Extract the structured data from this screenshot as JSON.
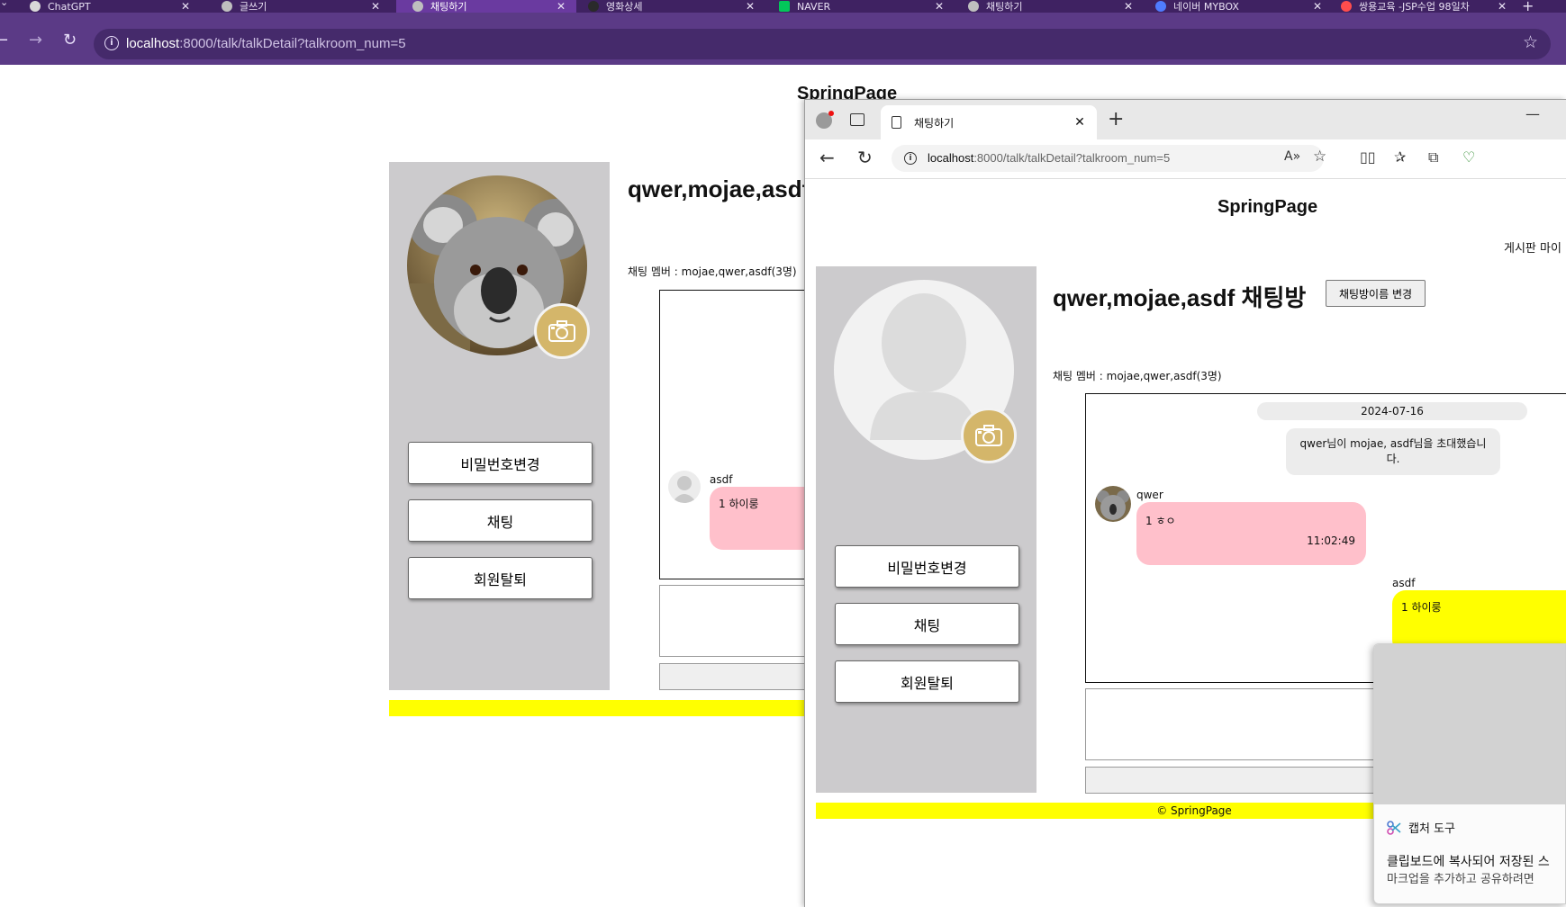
{
  "browser_back": {
    "tabs": [
      {
        "title": "ChatGPT",
        "active": false,
        "favicon_color": "#d9d9d9"
      },
      {
        "title": "글쓰기",
        "active": false,
        "favicon_color": "#bfbfbf"
      },
      {
        "title": "채팅하기",
        "active": true,
        "favicon_color": "#bfbfbf"
      },
      {
        "title": "영화상세",
        "active": false,
        "favicon_color": "#2a2a2a"
      },
      {
        "title": "NAVER",
        "active": false,
        "favicon_color": "#03c75a"
      },
      {
        "title": "채팅하기",
        "active": false,
        "favicon_color": "#bfbfbf"
      },
      {
        "title": "네이버 MYBOX",
        "active": false,
        "favicon_color": "#4f7cff"
      },
      {
        "title": "쌍용교육 -JSP수업 98일차",
        "active": false,
        "favicon_color": "#ff4d4d"
      }
    ],
    "close_glyph": "✕",
    "new_tab_glyph": "+",
    "url_host": "localhost",
    "url_rest": ":8000/talk/talkDetail?talkroom_num=5",
    "icons": {
      "back": "back-arrow-icon",
      "forward": "forward-arrow-icon",
      "reload": "reload-icon",
      "bookmark": "star-icon"
    }
  },
  "page_back": {
    "site_title": "SpringPage",
    "room_title": "qwer,mojae,asdf",
    "members": "채팅 멤버 : mojae,qwer,asdf(3명)",
    "sidebar_buttons": [
      "비밀번호변경",
      "채팅",
      "회원탈퇴"
    ],
    "message": {
      "sender": "asdf",
      "text": "1 하이룽",
      "bubble_color": "#ffc0cb"
    },
    "footer_color": "#ffff00"
  },
  "browser_front": {
    "tab_title": "채팅하기",
    "url_host": "localhost",
    "url_rest": ":8000/talk/talkDetail?talkroom_num=5",
    "close_glyph": "✕",
    "new_tab_glyph": "+",
    "minimize_glyph": "—"
  },
  "page_front": {
    "site_title": "SpringPage",
    "nav_text": "게시판 마이",
    "room_title": "qwer,mojae,asdf 채팅방",
    "rename_button": "채팅방이름 변경",
    "members": "채팅 멤버 : mojae,qwer,asdf(3명)",
    "sidebar_buttons": [
      "비밀번호변경",
      "채팅",
      "회원탈퇴"
    ],
    "date_badge": "2024-07-16",
    "system_message": [
      "qwer님이 mojae, asdf님을 초대했습니",
      "다."
    ],
    "messages": [
      {
        "sender": "qwer",
        "text": "1 ㅎㅇ",
        "time": "11:02:49",
        "bubble_color": "#ffc0cb"
      },
      {
        "sender": "asdf",
        "text": "1 하이룽",
        "bubble_color": "#ffff00"
      }
    ],
    "footer": "© SpringPage",
    "footer_color": "#ffff00"
  },
  "snip_toast": {
    "app_name": "캡처 도구",
    "line1": "클립보드에 복사되어 저장된 스",
    "line2": "마크업을 추가하고 공유하려면"
  },
  "colors": {
    "chrome_tabbar": "#3f2262",
    "chrome_toolbar": "#5b3a86",
    "sidebar_gray": "#cccbcd",
    "camera_badge": "#d4b66a"
  }
}
